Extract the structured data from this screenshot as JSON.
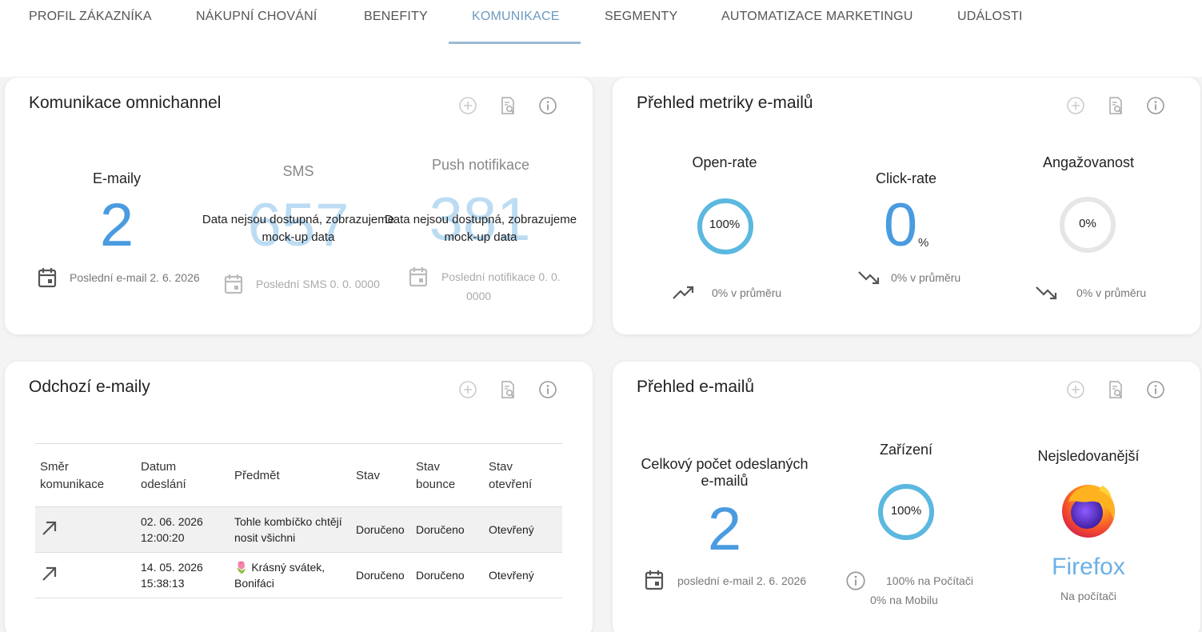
{
  "tabs": [
    {
      "label": "PROFIL ZÁKAZNÍKA"
    },
    {
      "label": "NÁKUPNÍ CHOVÁNÍ"
    },
    {
      "label": "BENEFITY"
    },
    {
      "label": "KOMUNIKACE",
      "active": true
    },
    {
      "label": "SEGMENTY"
    },
    {
      "label": "AUTOMATIZACE MARKETINGU"
    },
    {
      "label": "UDÁLOSTI"
    }
  ],
  "omnichannel": {
    "title": "Komunikace omnichannel",
    "emails": {
      "label": "E-maily",
      "value": "2",
      "last": "Poslední e-mail 2. 6. 2026"
    },
    "sms": {
      "label": "SMS",
      "value": "657",
      "overlay": "Data nejsou dostupná, zobrazujeme mock-up data",
      "last": "Poslední SMS 0. 0. 0000"
    },
    "push": {
      "label": "Push notifikace",
      "value": "381",
      "overlay": "Data nejsou dostupná, zobrazujeme mock-up data",
      "last_line1": "Poslední notifikace 0. 0.",
      "last_line2": "0000"
    }
  },
  "metrics": {
    "title": "Přehled metriky e-mailů",
    "open_rate": {
      "label": "Open-rate",
      "value": "100%",
      "fraction": 1.0,
      "trend": "0% v průměru",
      "trend_icon": "trend-up-icon"
    },
    "click_rate": {
      "label": "Click-rate",
      "value": "0",
      "unit": "%",
      "trend": "0% v průměru",
      "trend_icon": "trend-down-icon"
    },
    "engagement": {
      "label": "Angažovanost",
      "value": "0%",
      "fraction": 0.0,
      "trend": "0% v průměru",
      "trend_icon": "trend-down-icon"
    }
  },
  "outgoing": {
    "title": "Odchozí e-maily",
    "headers": [
      {
        "l1": "Směr",
        "l2": "komunikace"
      },
      {
        "l1": "Datum",
        "l2": "odeslání"
      },
      {
        "l1": "Předmět",
        "l2": ""
      },
      {
        "l1": "Stav",
        "l2": ""
      },
      {
        "l1": "Stav",
        "l2": "bounce"
      },
      {
        "l1": "Stav",
        "l2": "otevření"
      }
    ],
    "rows": [
      {
        "date": "02. 06. 2026",
        "time": "12:00:20",
        "subject_l1": "Tohle kombíčko chtějí",
        "subject_l2": "nosit všichni",
        "status": "Doručeno",
        "bounce": "Doručeno",
        "opened": "Otevřený"
      },
      {
        "date": "14. 05. 2026",
        "time": "15:38:13",
        "subject_l1": "🌷 Krásný svátek,",
        "subject_l2": "Bonifáci",
        "status": "Doručeno",
        "bounce": "Doručeno",
        "opened": "Otevřený"
      }
    ]
  },
  "overview": {
    "title": "Přehled e-mailů",
    "total": {
      "label_l1": "Celkový počet odeslaných",
      "label_l2": "e-mailů",
      "value": "2",
      "last": "poslední e-mail 2. 6. 2026"
    },
    "device": {
      "label": "Zařízení",
      "value": "100%",
      "fraction": 1.0,
      "desktop": "100% na Počítači",
      "mobile": "0% na Mobilu"
    },
    "top": {
      "label": "Nejsledovanější",
      "browser": "Firefox",
      "platform": "Na počítači"
    }
  },
  "colors": {
    "accent": "#4a9be0",
    "ring": "#5bb8e0",
    "ring_empty": "#e6e6e6",
    "tab_active": "#6d9ac0"
  }
}
